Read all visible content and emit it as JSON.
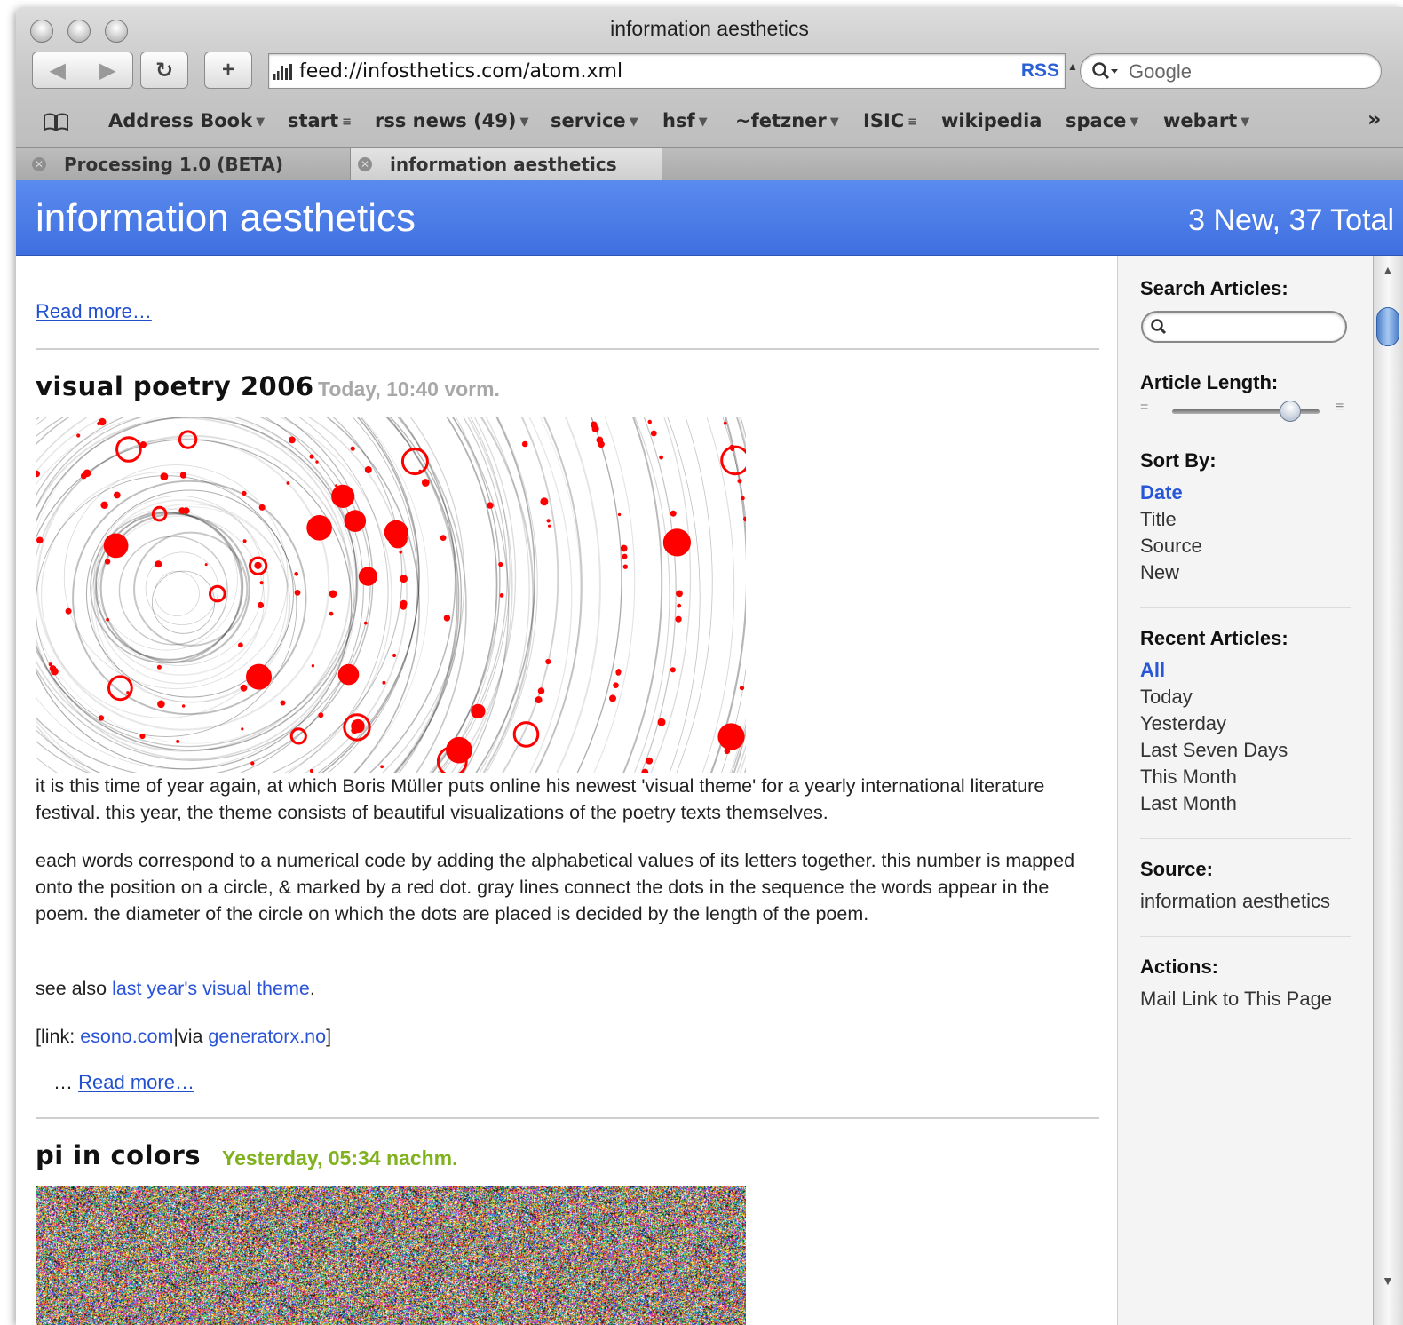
{
  "window": {
    "title": "information aesthetics"
  },
  "toolbar": {
    "address": "feed://infosthetics.com/atom.xml",
    "rss_label": "RSS",
    "search_placeholder": "Google"
  },
  "bookmarks": {
    "items": [
      {
        "label": "Address Book",
        "type": "menu"
      },
      {
        "label": "start",
        "type": "folder"
      },
      {
        "label": "rss news (49)",
        "type": "menu"
      },
      {
        "label": "service",
        "type": "menu"
      },
      {
        "label": "hsf",
        "type": "menu"
      },
      {
        "label": "~fetzner",
        "type": "menu"
      },
      {
        "label": "ISIC",
        "type": "folder"
      },
      {
        "label": "wikipedia",
        "type": "link"
      },
      {
        "label": "space",
        "type": "menu"
      },
      {
        "label": "webart",
        "type": "menu"
      }
    ],
    "overflow": "»"
  },
  "tabs": [
    {
      "label": "Processing 1.0 (BETA)",
      "active": false
    },
    {
      "label": "information aesthetics",
      "active": true
    }
  ],
  "feed": {
    "title": "information aesthetics",
    "count": "3 New, 37 Total"
  },
  "articles": {
    "top_read_more": "Read more…",
    "first": {
      "title": "visual poetry 2006",
      "date": "Today, 10:40 vorm.",
      "date_color": "#a8a8a8",
      "p1": "it is this time of year again, at which Boris Müller puts online his newest 'visual theme' for a yearly international literature festival. this year, the theme consists of beautiful visualizations of the poetry texts themselves.",
      "p2": "each words correspond to a numerical code by adding the alphabetical values of its letters together. this number is mapped onto the position on a circle, & marked by a red dot. gray lines connect the dots in the sequence the words appear in the poem. the diameter of the circle on which the dots are placed is decided by the length of the poem.",
      "p3_prefix": "see also ",
      "p3_link": "last year's visual theme",
      "p3_suffix": ".",
      "p4_prefix": "[link: ",
      "p4_link1": "esono.com",
      "p4_mid": "|via ",
      "p4_link2": "generatorx.no",
      "p4_suffix": "]",
      "ellipsis": "…",
      "read_more": "Read more…"
    },
    "second": {
      "title": "pi in colors",
      "date": "Yesterday, 05:34 nachm.",
      "date_color": "#7fb21d"
    }
  },
  "sidebar": {
    "search_heading": "Search Articles:",
    "length_heading": "Article Length:",
    "length_value": 0.8,
    "sort_heading": "Sort By:",
    "sort_options": [
      "Date",
      "Title",
      "Source",
      "New"
    ],
    "sort_selected": "Date",
    "recent_heading": "Recent Articles:",
    "recent_options": [
      "All",
      "Today",
      "Yesterday",
      "Last Seven Days",
      "This Month",
      "Last Month"
    ],
    "recent_selected": "All",
    "source_heading": "Source:",
    "source_value": "information aesthetics",
    "actions_heading": "Actions:",
    "actions": [
      "Mail Link to This Page"
    ]
  },
  "colors": {
    "header_blue": "#4a7ae6",
    "link_blue": "#2953d8",
    "poetry_red": "#ff0000"
  }
}
